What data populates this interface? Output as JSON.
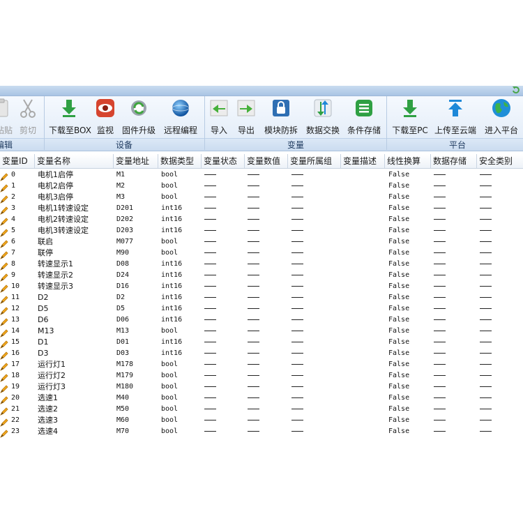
{
  "ribbon": {
    "edit": {
      "paste_label": "粘贴",
      "cut_label": "剪切",
      "group_label": "编辑"
    },
    "device": {
      "download_box_label": "下载至BOX",
      "monitor_label": "监视",
      "firmware_label": "固件升级",
      "remote_label": "远程编程",
      "group_label": "设备"
    },
    "variable": {
      "import_label": "导入",
      "export_label": "导出",
      "module_label": "模块防拆",
      "exchange_label": "数据交换",
      "storage_label": "条件存储",
      "group_label": "变量"
    },
    "platform": {
      "download_pc_label": "下载至PC",
      "upload_cloud_label": "上传至云端",
      "enter_platform_label": "进入平台",
      "group_label": "平台"
    }
  },
  "table": {
    "columns": [
      "变量ID",
      "变量名称",
      "变量地址",
      "数据类型",
      "变量状态",
      "变量数值",
      "变量所属组",
      "变量描述",
      "线性换算",
      "数据存储",
      "安全类别"
    ],
    "rows": [
      {
        "id": "0",
        "name": "电机1启停",
        "address": "M1",
        "type": "bool",
        "linear": "False"
      },
      {
        "id": "1",
        "name": "电机2启停",
        "address": "M2",
        "type": "bool",
        "linear": "False"
      },
      {
        "id": "2",
        "name": "电机3启停",
        "address": "M3",
        "type": "bool",
        "linear": "False"
      },
      {
        "id": "3",
        "name": "电机1转速设定",
        "address": "D201",
        "type": "int16",
        "linear": "False"
      },
      {
        "id": "4",
        "name": "电机2转速设定",
        "address": "D202",
        "type": "int16",
        "linear": "False"
      },
      {
        "id": "5",
        "name": "电机3转速设定",
        "address": "D203",
        "type": "int16",
        "linear": "False"
      },
      {
        "id": "6",
        "name": "联启",
        "address": "M077",
        "type": "bool",
        "linear": "False"
      },
      {
        "id": "7",
        "name": "联停",
        "address": "M90",
        "type": "bool",
        "linear": "False"
      },
      {
        "id": "8",
        "name": "转速显示1",
        "address": "D08",
        "type": "int16",
        "linear": "False"
      },
      {
        "id": "9",
        "name": "转速显示2",
        "address": "D24",
        "type": "int16",
        "linear": "False"
      },
      {
        "id": "10",
        "name": "转速显示3",
        "address": "D16",
        "type": "int16",
        "linear": "False"
      },
      {
        "id": "11",
        "name": "D2",
        "address": "D2",
        "type": "int16",
        "linear": "False"
      },
      {
        "id": "12",
        "name": "D5",
        "address": "D5",
        "type": "int16",
        "linear": "False"
      },
      {
        "id": "13",
        "name": "D6",
        "address": "D06",
        "type": "int16",
        "linear": "False"
      },
      {
        "id": "14",
        "name": "M13",
        "address": "M13",
        "type": "bool",
        "linear": "False"
      },
      {
        "id": "15",
        "name": "D1",
        "address": "D01",
        "type": "int16",
        "linear": "False"
      },
      {
        "id": "16",
        "name": "D3",
        "address": "D03",
        "type": "int16",
        "linear": "False"
      },
      {
        "id": "17",
        "name": "运行灯1",
        "address": "M178",
        "type": "bool",
        "linear": "False"
      },
      {
        "id": "18",
        "name": "运行灯2",
        "address": "M179",
        "type": "bool",
        "linear": "False"
      },
      {
        "id": "19",
        "name": "运行灯3",
        "address": "M180",
        "type": "bool",
        "linear": "False"
      },
      {
        "id": "20",
        "name": "选速1",
        "address": "M40",
        "type": "bool",
        "linear": "False"
      },
      {
        "id": "21",
        "name": "选速2",
        "address": "M50",
        "type": "bool",
        "linear": "False"
      },
      {
        "id": "22",
        "name": "选速3",
        "address": "M60",
        "type": "bool",
        "linear": "False"
      },
      {
        "id": "23",
        "name": "选速4",
        "address": "M70",
        "type": "bool",
        "linear": "False"
      }
    ]
  },
  "icons": {
    "row_icon": "pencil-icon",
    "download_color": "#2fa043",
    "upload_color": "#1e88d8",
    "monitor_color": "#d6452f",
    "accent": "#1e3a5f"
  }
}
